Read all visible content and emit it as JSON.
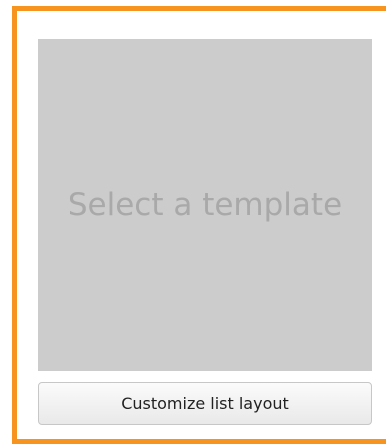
{
  "template_panel": {
    "preview_placeholder": "Select a template",
    "customize_button_label": "Customize list layout"
  },
  "colors": {
    "frame_border": "#f6941f",
    "preview_background": "#cccccc",
    "preview_text": "#a9a9a9"
  }
}
